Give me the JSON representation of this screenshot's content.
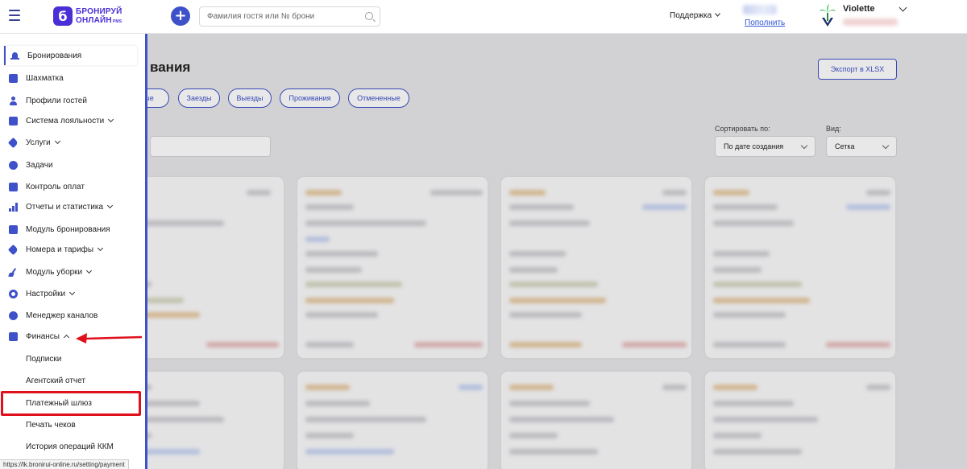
{
  "header": {
    "logo_line1": "БРОНИРУЙ",
    "logo_line2": "ОНЛАЙН",
    "logo_pms": "PMS",
    "logo_mark": "б",
    "add_label": "+",
    "search_placeholder": "Фамилия гостя или № брони",
    "support_label": "Поддержка",
    "topup_label": "Пополнить",
    "user_name": "Violette"
  },
  "page": {
    "title": "вания",
    "export_label": "Экспорт в XLSX",
    "filters": [
      "ые",
      "Заезды",
      "Выезды",
      "Проживания",
      "Отмененные"
    ],
    "sort_label": "Сортировать по:",
    "sort_value": "По дате создания",
    "view_label": "Вид:",
    "view_value": "Сетка"
  },
  "sidebar": {
    "items": [
      {
        "label": "Бронирования",
        "icon": "bell-icon"
      },
      {
        "label": "Шахматка",
        "icon": "calendar-icon"
      },
      {
        "label": "Профили гостей",
        "icon": "person-icon"
      },
      {
        "label": "Система лояльности",
        "icon": "loyalty-icon",
        "chevron": "down"
      },
      {
        "label": "Услуги",
        "icon": "tag-icon",
        "chevron": "down"
      },
      {
        "label": "Задачи",
        "icon": "tasks-icon"
      },
      {
        "label": "Контроль оплат",
        "icon": "payments-icon"
      },
      {
        "label": "Отчеты и статистика",
        "icon": "chart-icon",
        "chevron": "down"
      },
      {
        "label": "Модуль бронирования",
        "icon": "check-icon"
      },
      {
        "label": "Номера и тарифы",
        "icon": "tools-icon",
        "chevron": "down"
      },
      {
        "label": "Модуль уборки",
        "icon": "broom-icon",
        "chevron": "down"
      },
      {
        "label": "Настройки",
        "icon": "gear-icon",
        "chevron": "down"
      },
      {
        "label": "Менеджер каналов",
        "icon": "channels-icon"
      },
      {
        "label": "Финансы",
        "icon": "wallet-icon",
        "chevron": "up"
      }
    ],
    "sub_items": [
      "Подписки",
      "Агентский отчет",
      "Платежный шлюз",
      "Печать чеков",
      "История операций ККМ"
    ]
  },
  "status_url": "https://lk.bronirui-online.ru/setting/payment",
  "colors": {
    "accent": "#3f51c9",
    "brand": "#4b2fd6",
    "highlight": "#e0101c"
  }
}
